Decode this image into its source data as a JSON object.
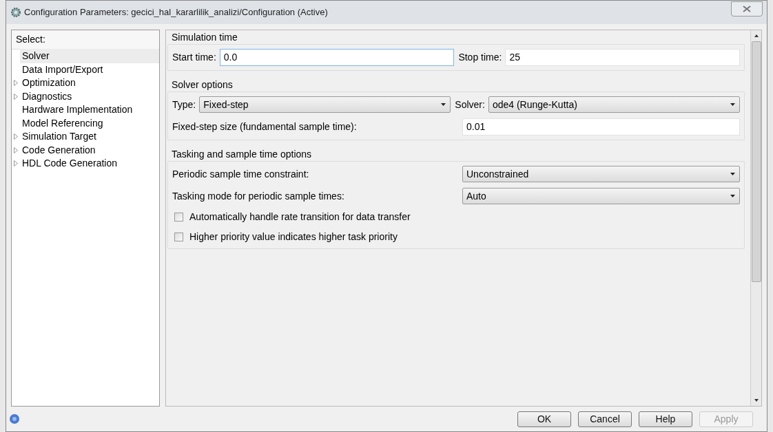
{
  "window": {
    "title": "Configuration Parameters: gecici_hal_kararlilik_analizi/Configuration (Active)"
  },
  "tree": {
    "heading": "Select:",
    "items": [
      {
        "label": "Solver",
        "expandable": false,
        "selected": true
      },
      {
        "label": "Data Import/Export",
        "expandable": false,
        "selected": false
      },
      {
        "label": "Optimization",
        "expandable": true,
        "selected": false
      },
      {
        "label": "Diagnostics",
        "expandable": true,
        "selected": false
      },
      {
        "label": "Hardware Implementation",
        "expandable": false,
        "selected": false
      },
      {
        "label": "Model Referencing",
        "expandable": false,
        "selected": false
      },
      {
        "label": "Simulation Target",
        "expandable": true,
        "selected": false
      },
      {
        "label": "Code Generation",
        "expandable": true,
        "selected": false
      },
      {
        "label": "HDL Code Generation",
        "expandable": true,
        "selected": false
      }
    ]
  },
  "sections": [
    {
      "title": "Simulation time",
      "rows": [
        {
          "kind": "pair",
          "fields": [
            {
              "label": "Start time:",
              "kind": "text",
              "value": "0.0",
              "focused": true
            },
            {
              "label": "Stop time:",
              "kind": "text",
              "value": "25",
              "focused": false
            }
          ]
        }
      ]
    },
    {
      "title": "Solver options",
      "rows": [
        {
          "kind": "pair",
          "fields": [
            {
              "label": "Type:",
              "kind": "select",
              "value": "Fixed-step"
            },
            {
              "label": "Solver:",
              "kind": "select",
              "value": "ode4 (Runge-Kutta)"
            }
          ]
        },
        {
          "kind": "wide",
          "label": "Fixed-step size (fundamental sample time):",
          "field": {
            "kind": "text",
            "value": "0.01"
          }
        }
      ]
    },
    {
      "title": "Tasking and sample time options",
      "rows": [
        {
          "kind": "wide",
          "label": "Periodic sample time constraint:",
          "field": {
            "kind": "select",
            "value": "Unconstrained"
          }
        },
        {
          "kind": "wide",
          "label": "Tasking mode for periodic sample times:",
          "field": {
            "kind": "select",
            "value": "Auto"
          }
        },
        {
          "kind": "checkbox",
          "label": "Automatically handle rate transition for data transfer",
          "checked": false
        },
        {
          "kind": "checkbox",
          "label": "Higher priority value indicates higher task priority",
          "checked": false
        }
      ]
    }
  ],
  "buttons": [
    {
      "label": "OK",
      "disabled": false
    },
    {
      "label": "Cancel",
      "disabled": false
    },
    {
      "label": "Help",
      "disabled": false
    },
    {
      "label": "Apply",
      "disabled": true
    }
  ]
}
